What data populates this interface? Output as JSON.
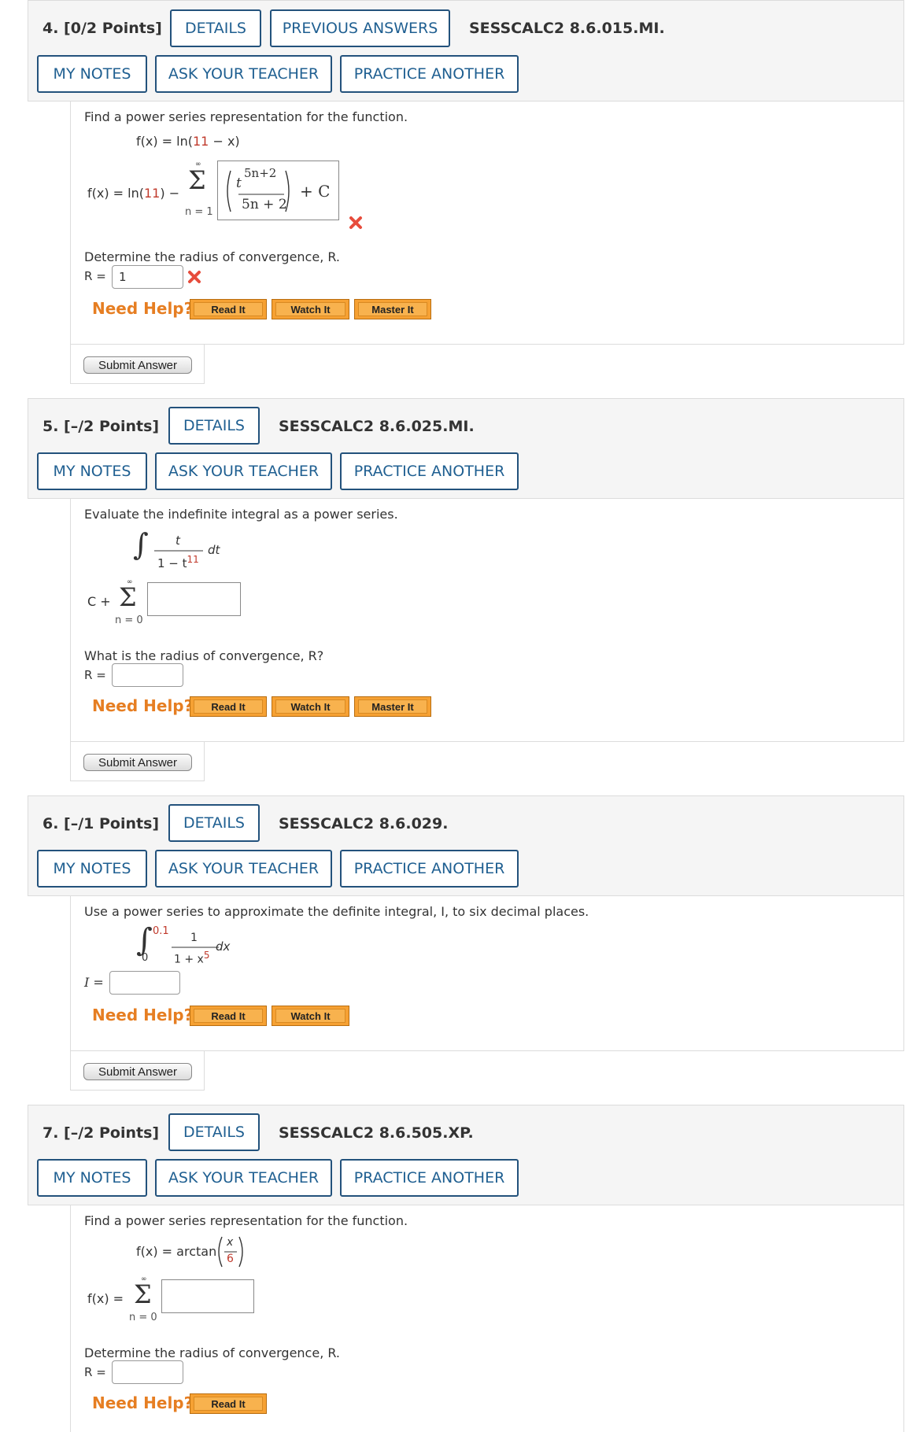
{
  "common": {
    "details": "DETAILS",
    "previous_answers": "PREVIOUS ANSWERS",
    "my_notes": "MY NOTES",
    "ask_teacher": "ASK YOUR TEACHER",
    "practice_another": "PRACTICE ANOTHER",
    "need_help": "Need Help?",
    "read_it": "Read It",
    "watch_it": "Watch It",
    "master_it": "Master It",
    "submit_answer": "Submit Answer"
  },
  "q4": {
    "number": "4. [0/2 Points]",
    "code": "SESSCALC2 8.6.015.MI.",
    "prompt": "Find a power series representation for the function.",
    "func_left": "f(x) = ln(",
    "func_num": "11",
    "func_right": " − x)",
    "ans_left_a": "f(x) = ln(",
    "ans_left_num": "11",
    "ans_left_b": ") −",
    "sum_top": "∞",
    "sum_symbol": "Σ",
    "sum_bottom": "n = 1",
    "entered_base": "t",
    "entered_exp": "5n+2",
    "entered_den": "5n + 2",
    "plus_c": "+ C",
    "radius_prompt": "Determine the radius of convergence, R.",
    "r_label": "R =",
    "r_value": "1"
  },
  "q5": {
    "number": "5. [–/2 Points]",
    "code": "SESSCALC2 8.6.025.MI.",
    "prompt": "Evaluate the indefinite integral as a power series.",
    "integral": "∫",
    "num": "t",
    "den_a": "1 − t",
    "den_exp": "11",
    "dt": "dt",
    "c_plus": "C +",
    "sum_top": "∞",
    "sum_symbol": "Σ",
    "sum_bottom": "n = 0",
    "radius_prompt": "What is the radius of convergence, R?",
    "r_label": "R ="
  },
  "q6": {
    "number": "6. [–/1 Points]",
    "code": "SESSCALC2 8.6.029.",
    "prompt": "Use a power series to approximate the definite integral, I, to six decimal places.",
    "integral": "∫",
    "upper": "0.1",
    "lower": "0",
    "num": "1",
    "den_a": "1 + x",
    "den_exp": "5",
    "dx": "dx",
    "i_label": "I ="
  },
  "q7": {
    "number": "7. [–/2 Points]",
    "code": "SESSCALC2 8.6.505.XP.",
    "prompt": "Find a power series representation for the function.",
    "func_left": "f(x) = arctan",
    "frac_num": "x",
    "frac_den": "6",
    "ans_left": "f(x) =",
    "sum_top": "∞",
    "sum_symbol": "Σ",
    "sum_bottom": "n = 0",
    "radius_prompt": "Determine the radius of convergence, R.",
    "r_label": "R ="
  },
  "colors": {
    "accent": "#1f5f91",
    "help": "#e67e22",
    "wrong": "#e74c3c",
    "num_red": "#c0392b"
  }
}
